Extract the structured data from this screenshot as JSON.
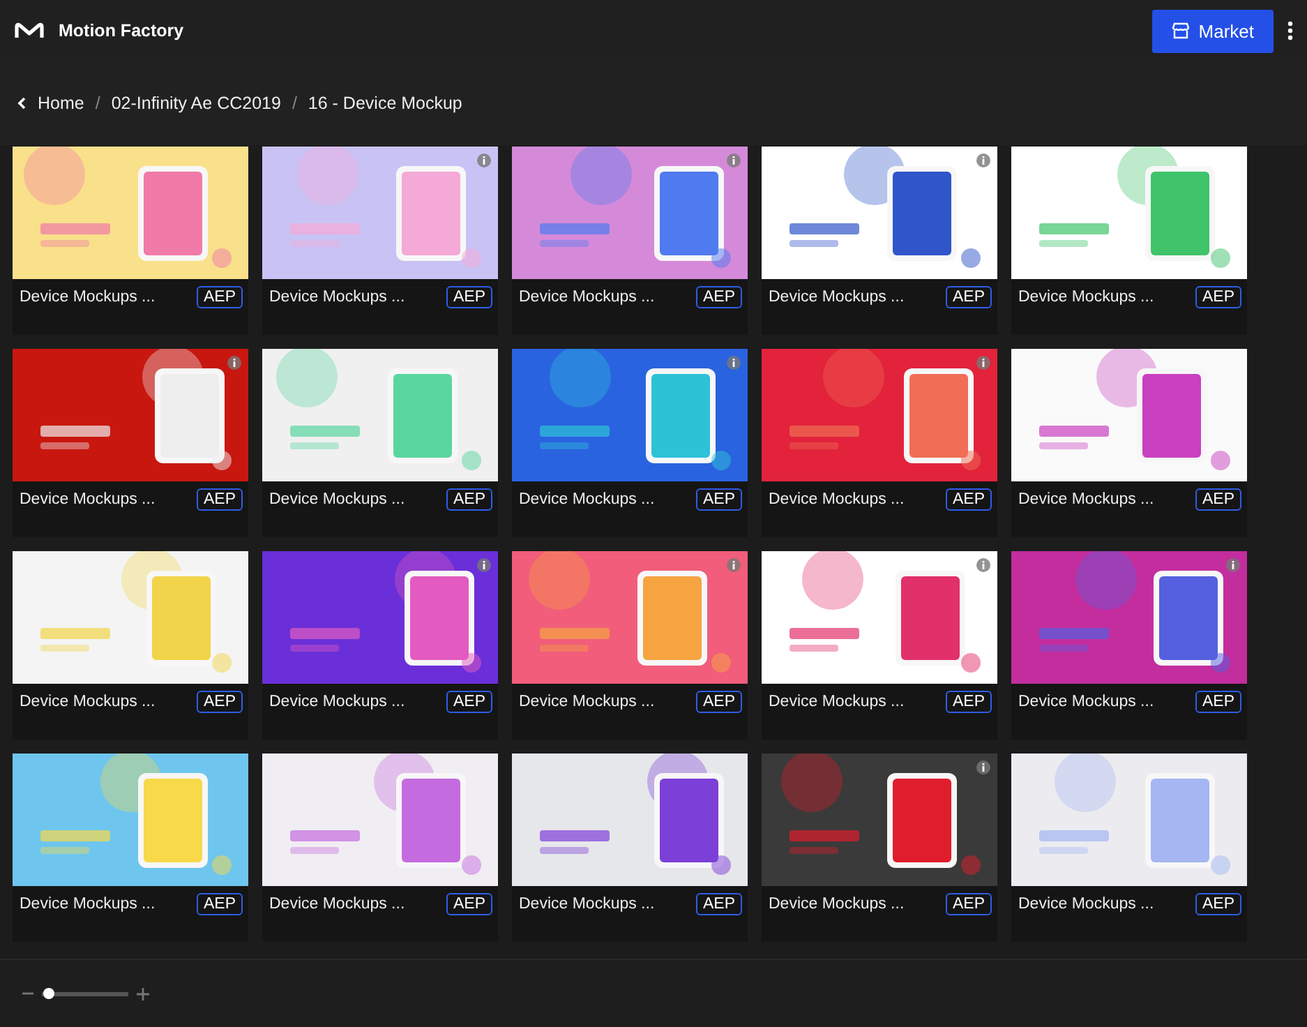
{
  "app": {
    "title": "Motion Factory",
    "market_button": "Market"
  },
  "breadcrumb": {
    "links": [
      "Home",
      "02-Infinity Ae CC2019",
      "16 - Device Mockup"
    ],
    "separators": [
      "/",
      "/"
    ]
  },
  "items": [
    {
      "kind": "picture",
      "title": "Device Mockups ...",
      "badge": "AEP",
      "info": false
    },
    {
      "kind": "picture",
      "title": "Device Mockups ...",
      "badge": "AEP",
      "info": true
    },
    {
      "kind": "picture",
      "title": "Device Mockups ...",
      "badge": "AEP",
      "info": true
    },
    {
      "kind": "picture",
      "title": "Device Mockups ...",
      "badge": "AEP",
      "info": true
    },
    {
      "kind": "picture",
      "title": "Device Mockups ...",
      "badge": "AEP",
      "info": false
    },
    {
      "kind": "picture",
      "title": "Device Mockups ...",
      "badge": "AEP",
      "info": true
    },
    {
      "kind": "picture",
      "title": "Device Mockups ...",
      "badge": "AEP",
      "info": false
    },
    {
      "kind": "picture",
      "title": "Device Mockups ...",
      "badge": "AEP",
      "info": true
    },
    {
      "kind": "picture",
      "title": "Device Mockups ...",
      "badge": "AEP",
      "info": true
    },
    {
      "kind": "picture",
      "title": "Device Mockups ...",
      "badge": "AEP",
      "info": false
    },
    {
      "kind": "picture",
      "title": "Device Mockups ...",
      "badge": "AEP",
      "info": false
    },
    {
      "kind": "picture",
      "title": "Device Mockups ...",
      "badge": "AEP",
      "info": true
    },
    {
      "kind": "picture",
      "title": "Device Mockups ...",
      "badge": "AEP",
      "info": true
    },
    {
      "kind": "picture",
      "title": "Device Mockups ...",
      "badge": "AEP",
      "info": true
    },
    {
      "kind": "picture",
      "title": "Device Mockups ...",
      "badge": "AEP",
      "info": true
    },
    {
      "kind": "picture",
      "title": "Device Mockups ...",
      "badge": "AEP",
      "info": false
    },
    {
      "kind": "picture",
      "title": "Device Mockups ...",
      "badge": "AEP",
      "info": false
    },
    {
      "kind": "picture",
      "title": "Device Mockups ...",
      "badge": "AEP",
      "info": false
    },
    {
      "kind": "picture",
      "title": "Device Mockups ...",
      "badge": "AEP",
      "info": true
    },
    {
      "kind": "picture",
      "title": "Device Mockups ...",
      "badge": "AEP",
      "info": false
    }
  ],
  "zoom_slider": {
    "level": 0.08
  }
}
